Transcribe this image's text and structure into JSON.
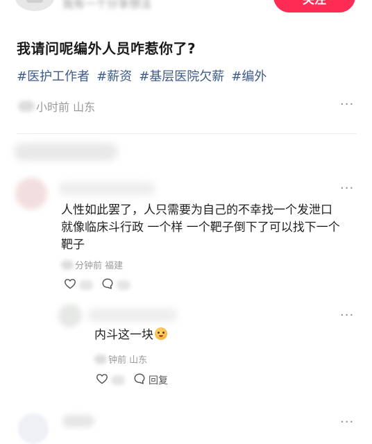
{
  "header": {
    "follow_label": "关注",
    "author_name": "我有一个分享想法"
  },
  "post": {
    "title": "我请问呢编外人员咋惹你了?",
    "tags": [
      "#医护工作者",
      "#薪资",
      "#基层医院欠薪",
      "#编外"
    ],
    "meta": "小时前 山东"
  },
  "comments": [
    {
      "text_lines": [
        "人性如此罢了，人只需要为自己的不幸找一个发泄口",
        "就像临床斗行政 一个样 一个靶子倒下了可以找下一个",
        "靶子"
      ],
      "meta": "分钟前 福建"
    }
  ],
  "reply": {
    "text": "内斗这一块",
    "meta": "钟前 山东",
    "reply_label": "回复"
  },
  "icons": {
    "more": "more-horizontal-icon",
    "like": "heart-outline-icon",
    "comment": "comment-bubble-icon"
  },
  "colors": {
    "accent": "#fe2c55",
    "tag": "#3d5a8c",
    "meta": "#999999"
  }
}
